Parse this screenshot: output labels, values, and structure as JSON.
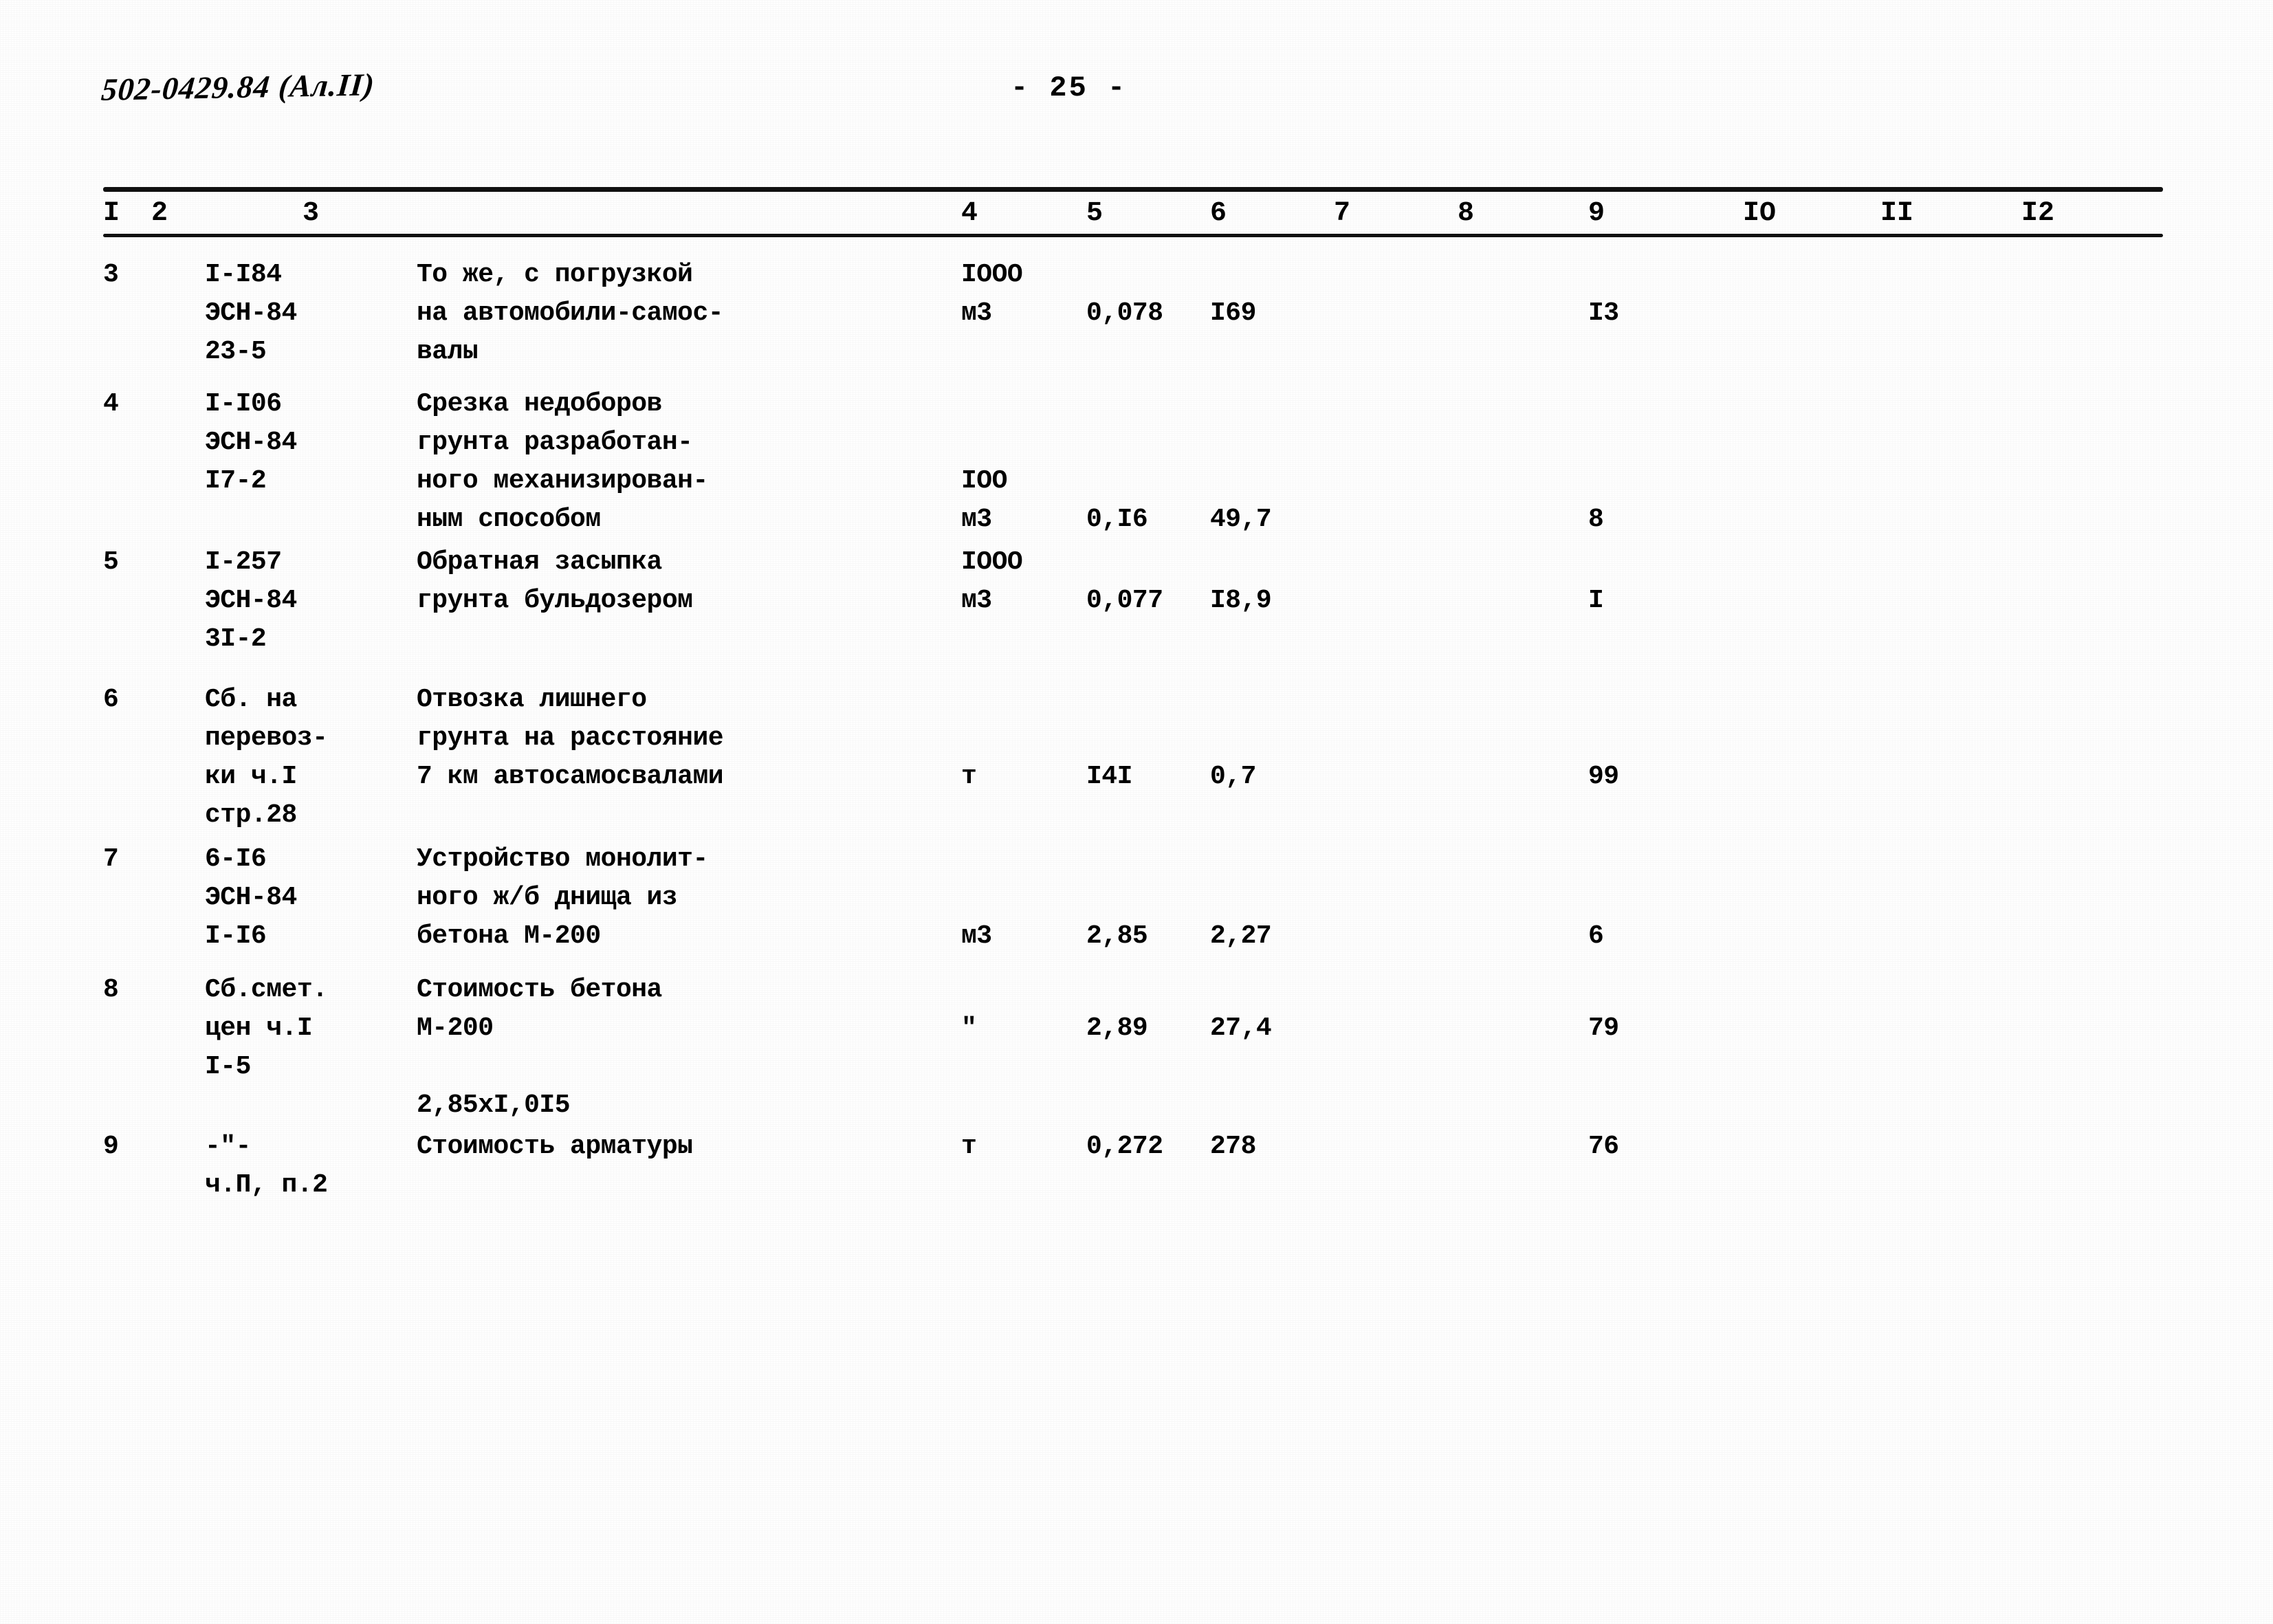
{
  "document": {
    "code": "502-0429.84 (Ал.II)",
    "page_label": "- 25 -"
  },
  "table": {
    "column_headers": [
      "I",
      "2",
      "3",
      "4",
      "5",
      "6",
      "7",
      "8",
      "9",
      "IO",
      "II",
      "I2"
    ],
    "rows": [
      {
        "num": "3",
        "code_lines": [
          "I-I84",
          "ЭСН-84",
          "23-5"
        ],
        "desc_lines": [
          "То же, с погрузкой",
          "на автомобили-самос-",
          "валы"
        ],
        "unit_lines": [
          "IOOO",
          "м3"
        ],
        "col5": "0,078",
        "col6": "I69",
        "col7": "",
        "col8": "",
        "col9": "I3",
        "col10": "",
        "col11": "",
        "col12": ""
      },
      {
        "num": "4",
        "code_lines": [
          "I-I06",
          "ЭСН-84",
          "I7-2"
        ],
        "desc_lines": [
          "Срезка недоборов",
          "грунта разработан-",
          "ного механизирован-",
          "ным способом"
        ],
        "unit_lines": [
          "IOO",
          "м3"
        ],
        "col5": "0,I6",
        "col6": "49,7",
        "col7": "",
        "col8": "",
        "col9": "8",
        "col10": "",
        "col11": "",
        "col12": ""
      },
      {
        "num": "5",
        "code_lines": [
          "I-257",
          "ЭСН-84",
          "3I-2"
        ],
        "desc_lines": [
          "Обратная засыпка",
          "грунта бульдозером"
        ],
        "unit_lines": [
          "IOOO",
          "м3"
        ],
        "col5": "0,077",
        "col6": "I8,9",
        "col7": "",
        "col8": "",
        "col9": "I",
        "col10": "",
        "col11": "",
        "col12": ""
      },
      {
        "num": "6",
        "code_lines": [
          "Сб. на",
          "перевоз-",
          "ки ч.I",
          "стр.28"
        ],
        "desc_lines": [
          "Отвозка лишнего",
          "грунта на расстояние",
          "7 км автосамосвалами"
        ],
        "unit_lines": [
          "т"
        ],
        "col5": "I4I",
        "col6": "0,7",
        "col7": "",
        "col8": "",
        "col9": "99",
        "col10": "",
        "col11": "",
        "col12": ""
      },
      {
        "num": "7",
        "code_lines": [
          "6-I6",
          "ЭСН-84",
          "I-I6"
        ],
        "desc_lines": [
          "Устройство монолит-",
          "ного ж/б днища из",
          "бетона М-200"
        ],
        "unit_lines": [
          "м3"
        ],
        "col5": "2,85",
        "col6": "2,27",
        "col7": "",
        "col8": "",
        "col9": "6",
        "col10": "",
        "col11": "",
        "col12": ""
      },
      {
        "num": "8",
        "code_lines": [
          "Сб.смет.",
          "цен ч.I",
          "I-5"
        ],
        "desc_lines": [
          "Стоимость бетона",
          "М-200",
          "",
          "2,85xI,0I5"
        ],
        "unit_lines": [
          "\""
        ],
        "col5": "2,89",
        "col6": "27,4",
        "col7": "",
        "col8": "",
        "col9": "79",
        "col10": "",
        "col11": "",
        "col12": ""
      },
      {
        "num": "9",
        "code_lines": [
          "-\"-",
          "ч.П, п.2"
        ],
        "desc_lines": [
          "Стоимость арматуры"
        ],
        "unit_lines": [
          "т"
        ],
        "col5": "0,272",
        "col6": "278",
        "col7": "",
        "col8": "",
        "col9": "76",
        "col10": "",
        "col11": "",
        "col12": ""
      }
    ]
  }
}
